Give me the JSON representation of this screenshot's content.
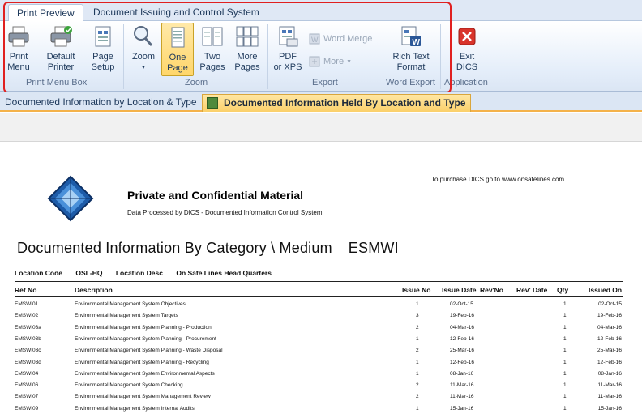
{
  "ribbon": {
    "tabs": [
      {
        "label": "Print Preview",
        "active": true
      },
      {
        "label": "Document Issuing and Control System",
        "active": false
      }
    ],
    "buttons": {
      "print_menu": "Print\nMenu",
      "default_printer": "Default\nPrinter",
      "page_setup": "Page\nSetup",
      "zoom": "Zoom",
      "one_page": "One\nPage",
      "two_pages": "Two\nPages",
      "more_pages": "More\nPages",
      "pdf_xps": "PDF\nor XPS",
      "word_merge": "Word Merge",
      "more": "More",
      "rich_text": "Rich Text\nFormat",
      "exit_dics": "Exit\nDICS"
    },
    "groups": {
      "print_menu_box": "Print Menu Box",
      "zoom": "Zoom",
      "export": "Export",
      "word_export": "Word Export",
      "application": "Application"
    }
  },
  "doc_tabs": [
    {
      "label": "Documented Information by Location & Type",
      "active": false
    },
    {
      "label": "Documented Information Held By Location and Type",
      "active": true
    }
  ],
  "report": {
    "purchase_note": "To purchase DICS go to www.onsafelines.com",
    "confidential_title": "Private and Confidential Material",
    "confidential_sub": "Data Processed by DICS - Documented Information Control System",
    "title": "Documented Information By Category \\ Medium",
    "title_code": "ESMWI",
    "location_code_label": "Location Code",
    "location_code": "OSL-HQ",
    "location_desc_label": "Location Desc",
    "location_desc": "On Safe Lines Head Quarters",
    "columns": {
      "ref_no": "Ref No",
      "description": "Description",
      "issue_no": "Issue No",
      "issue_date": "Issue Date",
      "rev_no": "Rev'No",
      "rev_date": "Rev' Date",
      "qty": "Qty",
      "issued_on": "Issued On"
    },
    "rows": [
      {
        "ref": "EMSWI01",
        "desc": "Environmental Management System Objectives",
        "issue_no": "1",
        "issue_date": "02-Oct-15",
        "qty": "1",
        "issued_on": "02-Oct-15"
      },
      {
        "ref": "EMSWI02",
        "desc": "Environmental Management System Targets",
        "issue_no": "3",
        "issue_date": "19-Feb-16",
        "qty": "1",
        "issued_on": "19-Feb-16"
      },
      {
        "ref": "EMSWI03a",
        "desc": "Environmental Management System Planning - Production",
        "issue_no": "2",
        "issue_date": "04-Mar-16",
        "qty": "1",
        "issued_on": "04-Mar-16"
      },
      {
        "ref": "EMSWI03b",
        "desc": "Environmental Management System Planning - Procurement",
        "issue_no": "1",
        "issue_date": "12-Feb-16",
        "qty": "1",
        "issued_on": "12-Feb-16"
      },
      {
        "ref": "EMSWI03c",
        "desc": "Environmental Management System Planning - Waste Disposal",
        "issue_no": "2",
        "issue_date": "25-Mar-16",
        "qty": "1",
        "issued_on": "25-Mar-16"
      },
      {
        "ref": "EMSWI03d",
        "desc": "Environmental Management System Planning - Recycling",
        "issue_no": "1",
        "issue_date": "12-Feb-16",
        "qty": "1",
        "issued_on": "12-Feb-16"
      },
      {
        "ref": "EMSWI04",
        "desc": "Environmental Management System Environmental Aspects",
        "issue_no": "1",
        "issue_date": "08-Jan-16",
        "qty": "1",
        "issued_on": "08-Jan-16"
      },
      {
        "ref": "EMSWI06",
        "desc": "Environmental Management System Checking",
        "issue_no": "2",
        "issue_date": "11-Mar-16",
        "qty": "1",
        "issued_on": "11-Mar-16"
      },
      {
        "ref": "EMSWI07",
        "desc": "Environmental Management System Management Review",
        "issue_no": "2",
        "issue_date": "11-Mar-16",
        "qty": "1",
        "issued_on": "11-Mar-16"
      },
      {
        "ref": "EMSWI09",
        "desc": "Environmental Management System Internal Audits",
        "issue_no": "1",
        "issue_date": "15-Jan-16",
        "qty": "1",
        "issued_on": "15-Jan-16"
      }
    ]
  }
}
